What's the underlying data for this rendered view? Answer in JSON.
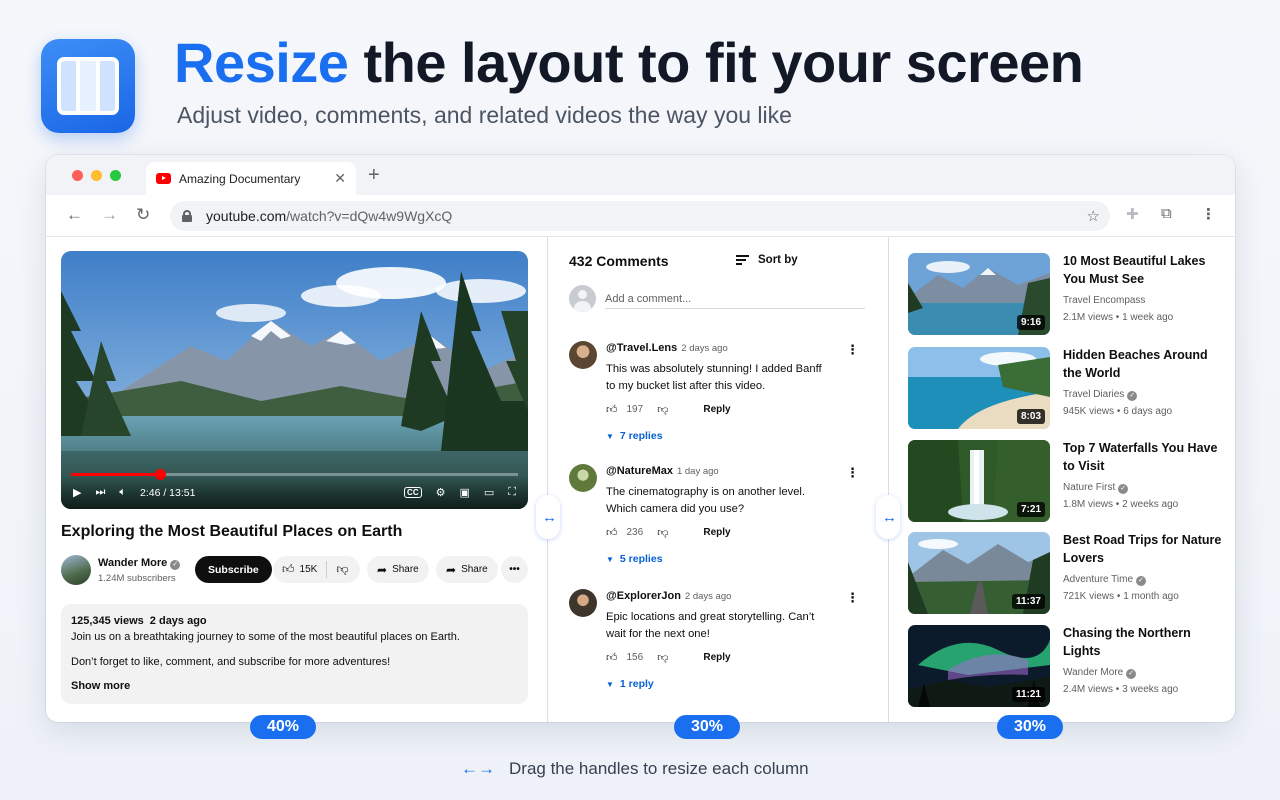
{
  "hero": {
    "title_accent": "Resize",
    "title_rest": "the layout to fit your screen",
    "subtitle": "Adjust video, comments, and related videos the way you like"
  },
  "browser": {
    "tab_title": "Amazing Documentary",
    "url_host": "youtube.com",
    "url_path": "/watch?v=dQw4w9WgXcQ",
    "traffic_lights": [
      "#ff5f57",
      "#febc2e",
      "#28c840"
    ]
  },
  "video": {
    "time": "2:46 / 13:51",
    "progress": 0.2,
    "title": "Exploring the Most Beautiful Places on Earth",
    "channel": "Wander More",
    "subscribers": "1.24M subscribers",
    "subscribe_label": "Subscribe",
    "likes": "15K",
    "share_label": "Share",
    "share2_label": "Share",
    "views": "125,345 views",
    "posted": "2 days ago",
    "desc1": "Join us on a breathtaking journey to some of the most beautiful places on Earth.",
    "desc2": "Don’t forget to like, comment, and subscribe for more adventures!",
    "show_more": "Show more"
  },
  "comments": {
    "count_label": "432 Comments",
    "sort_label": "Sort by",
    "add_placeholder": "Add a comment...",
    "items": [
      {
        "author": "@Travel.Lens",
        "time": "2 days ago",
        "text": "This was absolutely stunning! I added Banff to my bucket list after this video.",
        "likes": "197",
        "reply_label": "Reply",
        "replies": "7 replies"
      },
      {
        "author": "@NatureMax",
        "time": "1 day ago",
        "text": "The cinematography is on another level. Which camera did you use?",
        "likes": "236",
        "reply_label": "Reply",
        "replies": "5 replies"
      },
      {
        "author": "@ExplorerJon",
        "time": "2 days ago",
        "text": "Epic locations and great storytelling. Can’t wait for the next one!",
        "likes": "156",
        "reply_label": "Reply",
        "replies": "1 reply"
      }
    ]
  },
  "related": [
    {
      "title": "10 Most Beautiful Lakes You Must See",
      "channel": "Travel Encompass",
      "verified": false,
      "meta": "2.1M views • 1 week ago",
      "duration": "9:16"
    },
    {
      "title": "Hidden Beaches Around the World",
      "channel": "Travel Diaries",
      "verified": true,
      "meta": "945K views • 6 days ago",
      "duration": "8:03"
    },
    {
      "title": "Top 7 Waterfalls You Have to Visit",
      "channel": "Nature First",
      "verified": true,
      "meta": "1.8M views • 2 weeks ago",
      "duration": "7:21"
    },
    {
      "title": "Best Road Trips for Nature Lovers",
      "channel": "Adventure Time",
      "verified": true,
      "meta": "721K views • 1 month ago",
      "duration": "11:37"
    },
    {
      "title": "Chasing the Northern Lights",
      "channel": "Wander More",
      "verified": true,
      "meta": "2.4M views • 3 weeks ago",
      "duration": "11:21"
    }
  ],
  "columns": {
    "video_pct": "40%",
    "comments_pct": "30%",
    "related_pct": "30%"
  },
  "footer": {
    "hint": "Drag the handles to resize each column"
  },
  "icons": {
    "app": "three-column-layout-icon",
    "back": "arrow-left-icon",
    "forward": "arrow-right-icon",
    "reload": "reload-icon",
    "bookmark": "star-icon",
    "extensions": "puzzle-icon",
    "menu": "kebab-icon"
  },
  "colors": {
    "accent": "#1a6ff0",
    "youtube_red": "#ff0000",
    "link_blue": "#065fd4"
  }
}
